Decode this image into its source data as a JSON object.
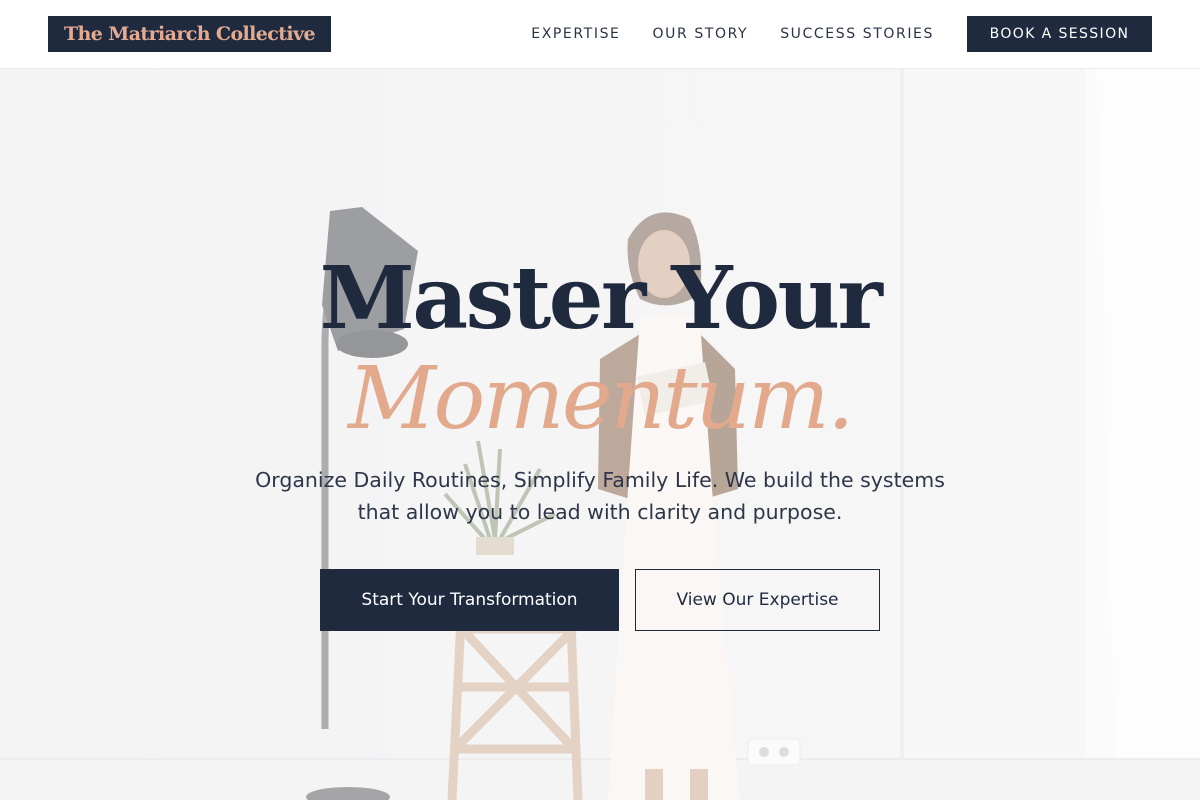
{
  "header": {
    "brand": "The Matriarch Collective",
    "nav": [
      {
        "label": "EXPERTISE"
      },
      {
        "label": "OUR STORY"
      },
      {
        "label": "SUCCESS STORIES"
      }
    ],
    "cta_label": "BOOK A SESSION"
  },
  "hero": {
    "title_line1": "Master Your",
    "title_line2": "Momentum.",
    "lead": "Organize Daily Routines, Simplify Family Life. We build the systems that allow you to lead with clarity and purpose.",
    "primary_button": "Start Your Transformation",
    "secondary_button": "View Our Expertise"
  },
  "colors": {
    "navy": "#1f2a3f",
    "accent": "#e3a98c",
    "white": "#ffffff"
  },
  "icons": [
    "floor-lamp-icon",
    "potted-plant-icon",
    "step-ladder-icon",
    "power-outlet-icon"
  ]
}
